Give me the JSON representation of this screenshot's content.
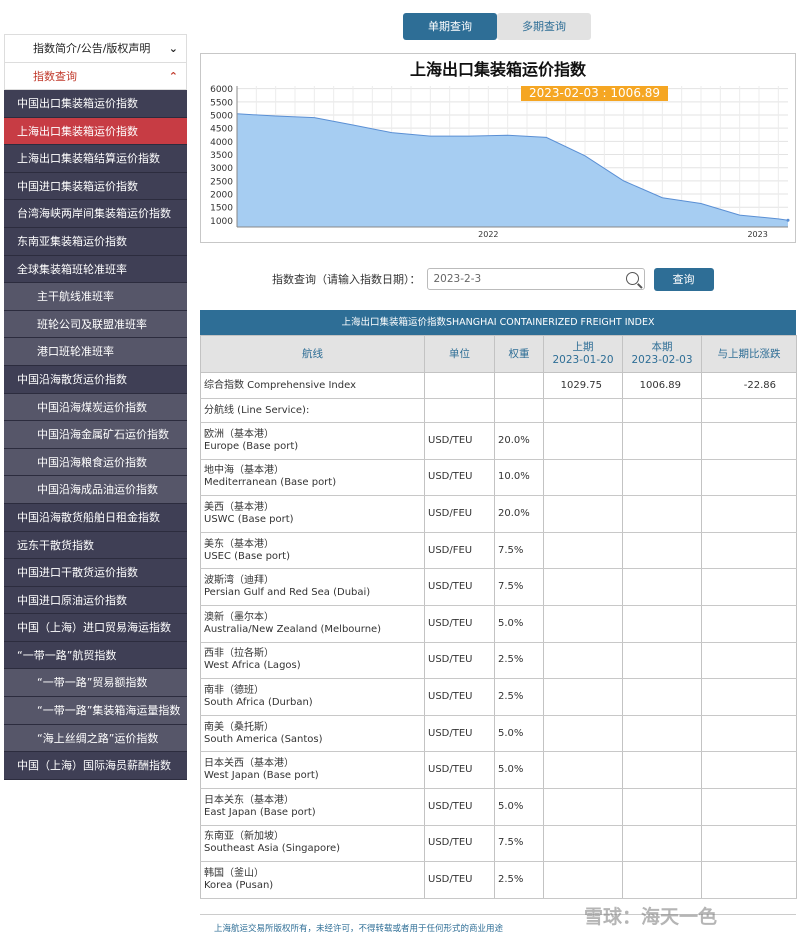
{
  "sidebar": {
    "top_items": [
      {
        "label": "指数简介/公告/版权声明",
        "chev": "⌄"
      },
      {
        "label": "指数查询",
        "chev": "⌃"
      }
    ],
    "items": [
      {
        "label": "中国出口集装箱运价指数",
        "level": 1
      },
      {
        "label": "上海出口集装箱运价指数",
        "level": 1,
        "active": true
      },
      {
        "label": "上海出口集装箱结算运价指数",
        "level": 1
      },
      {
        "label": "中国进口集装箱运价指数",
        "level": 1
      },
      {
        "label": "台湾海峡两岸间集装箱运价指数",
        "level": 1
      },
      {
        "label": "东南亚集装箱运价指数",
        "level": 1
      },
      {
        "label": "全球集装箱班轮准班率",
        "level": 1
      },
      {
        "label": "主干航线准班率",
        "level": 2
      },
      {
        "label": "班轮公司及联盟准班率",
        "level": 2
      },
      {
        "label": "港口班轮准班率",
        "level": 2
      },
      {
        "label": "中国沿海散货运价指数",
        "level": 1
      },
      {
        "label": "中国沿海煤炭运价指数",
        "level": 2
      },
      {
        "label": "中国沿海金属矿石运价指数",
        "level": 2
      },
      {
        "label": "中国沿海粮食运价指数",
        "level": 2
      },
      {
        "label": "中国沿海成品油运价指数",
        "level": 2
      },
      {
        "label": "中国沿海散货船舶日租金指数",
        "level": 1
      },
      {
        "label": "远东干散货指数",
        "level": 1
      },
      {
        "label": "中国进口干散货运价指数",
        "level": 1
      },
      {
        "label": "中国进口原油运价指数",
        "level": 1
      },
      {
        "label": "中国（上海）进口贸易海运指数",
        "level": 1
      },
      {
        "label": "“一带一路”航贸指数",
        "level": 1
      },
      {
        "label": "“一带一路”贸易额指数",
        "level": 2
      },
      {
        "label": "“一带一路”集装箱海运量指数",
        "level": 2
      },
      {
        "label": "“海上丝绸之路”运价指数",
        "level": 2
      },
      {
        "label": "中国（上海）国际海员薪酬指数",
        "level": 1
      }
    ]
  },
  "tabs": {
    "single": "单期查询",
    "multi": "多期查询"
  },
  "chart_data": {
    "type": "area",
    "title": "上海出口集装箱运价指数",
    "tooltip": "2023-02-03 : 1006.89",
    "yticks": [
      1000,
      1500,
      2000,
      2500,
      3000,
      3500,
      4000,
      4500,
      5000,
      5500,
      6000
    ],
    "ylim": [
      750,
      6100
    ],
    "x_tick_labels": [
      "2022",
      "2023"
    ],
    "x": [
      "2021-12-31",
      "2022-01-28",
      "2022-02-25",
      "2022-03-25",
      "2022-04-22",
      "2022-05-20",
      "2022-06-17",
      "2022-07-15",
      "2022-08-12",
      "2022-09-09",
      "2022-10-07",
      "2022-11-04",
      "2022-12-02",
      "2022-12-30",
      "2023-01-27",
      "2023-02-03"
    ],
    "values": [
      5047,
      4960,
      4900,
      4620,
      4330,
      4200,
      4200,
      4230,
      4150,
      3450,
      2500,
      1860,
      1640,
      1200,
      1060,
      1006.89
    ],
    "fill": "#a6cdf2",
    "line": "#5a8fd4"
  },
  "query": {
    "label": "指数查询（请输入指数日期）：",
    "value": "2023-2-3",
    "button": "查询"
  },
  "table": {
    "caption": "上海出口集装箱运价指数SHANGHAI CONTAINERIZED FREIGHT INDEX",
    "headers": {
      "route": "航线",
      "unit": "单位",
      "weight": "权重",
      "prev_top": "上期",
      "prev_date": "2023-01-20",
      "curr_top": "本期",
      "curr_date": "2023-02-03",
      "change": "与上期比涨跌"
    },
    "composite": {
      "name": "综合指数 Comprehensive Index",
      "prev": "1029.75",
      "curr": "1006.89",
      "change": "-22.86"
    },
    "section": "分航线 (Line Service):",
    "rows": [
      {
        "cn": "欧洲（基本港）",
        "en": "Europe (Base port)",
        "unit": "USD/TEU",
        "weight": "20.0%"
      },
      {
        "cn": "地中海（基本港）",
        "en": "Mediterranean (Base port)",
        "unit": "USD/TEU",
        "weight": "10.0%"
      },
      {
        "cn": "美西（基本港）",
        "en": "USWC (Base port)",
        "unit": "USD/FEU",
        "weight": "20.0%"
      },
      {
        "cn": "美东（基本港）",
        "en": "USEC (Base port)",
        "unit": "USD/FEU",
        "weight": "7.5%"
      },
      {
        "cn": "波斯湾（迪拜）",
        "en": "Persian Gulf and Red Sea (Dubai)",
        "unit": "USD/TEU",
        "weight": "7.5%"
      },
      {
        "cn": "澳新（墨尔本）",
        "en": "Australia/New Zealand (Melbourne)",
        "unit": "USD/TEU",
        "weight": "5.0%"
      },
      {
        "cn": "西非（拉各斯）",
        "en": "West Africa (Lagos)",
        "unit": "USD/TEU",
        "weight": "2.5%"
      },
      {
        "cn": "南非（德班）",
        "en": "South Africa (Durban)",
        "unit": "USD/TEU",
        "weight": "2.5%"
      },
      {
        "cn": "南美（桑托斯）",
        "en": "South America (Santos)",
        "unit": "USD/TEU",
        "weight": "5.0%"
      },
      {
        "cn": "日本关西（基本港）",
        "en": "West Japan (Base port)",
        "unit": "USD/TEU",
        "weight": "5.0%"
      },
      {
        "cn": "日本关东（基本港）",
        "en": "East Japan (Base port)",
        "unit": "USD/TEU",
        "weight": "5.0%"
      },
      {
        "cn": "东南亚（新加坡）",
        "en": "Southeast Asia (Singapore)",
        "unit": "USD/TEU",
        "weight": "7.5%"
      },
      {
        "cn": "韩国（釜山）",
        "en": "Korea (Pusan)",
        "unit": "USD/TEU",
        "weight": "2.5%"
      }
    ]
  },
  "footer": "上海航运交易所版权所有，未经许可，不得转载或者用于任何形式的商业用途",
  "watermark": "雪球：海天一色"
}
